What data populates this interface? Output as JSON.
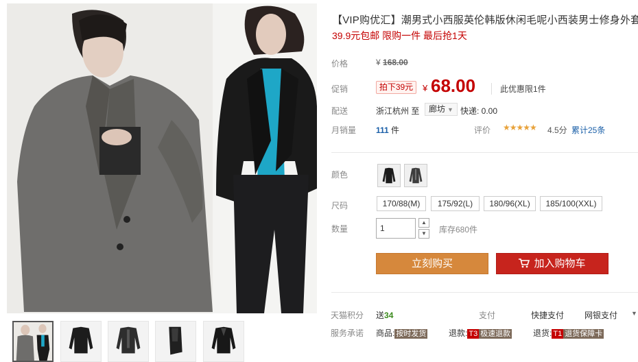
{
  "product": {
    "title": "【VIP购优汇】潮男式小西服英伦韩版休闲毛呢小西装男士修身外套",
    "subtitle": "39.9元包邮 限购一件 最后抢1天"
  },
  "labels": {
    "price": "价格",
    "promo": "促销",
    "shipping": "配送",
    "monthly_sales": "月销量",
    "rating": "评价",
    "color": "颜色",
    "size": "尺码",
    "quantity": "数量",
    "tmall_points": "天猫积分",
    "payment": "支付",
    "service": "服务承诺"
  },
  "price": {
    "currency": "¥",
    "original": "168.00",
    "promo_tag": "拍下39元",
    "current": "68.00",
    "limit_note": "此优惠限1件"
  },
  "shipping": {
    "from": "浙江杭州 至",
    "destination": "廊坊",
    "express": "快递: 0.00"
  },
  "sales": {
    "count": "111",
    "unit": " 件"
  },
  "rating": {
    "stars": 4.5,
    "stars_glyphs": "★★★★★",
    "score": "4.5分",
    "reviews": "累计25条"
  },
  "colors": [
    {
      "name": "black",
      "hex": "#1b1b1b"
    },
    {
      "name": "gray",
      "hex": "#6b6b6b"
    }
  ],
  "sizes": [
    "170/88(M)",
    "175/92(L)",
    "180/96(XL)",
    "185/100(XXL)"
  ],
  "quantity": {
    "value": "1",
    "stock": "库存680件"
  },
  "buttons": {
    "buy_now": "立刻购买",
    "add_to_cart": "加入购物车"
  },
  "points": {
    "prefix": "送",
    "value": "34"
  },
  "payment": {
    "method1": "快捷支付",
    "method2": "网银支付"
  },
  "service": {
    "item1_label": "商品:",
    "item1_badge": "按时发货",
    "item2_label": "退款:",
    "item2_badge_code": "T3",
    "item2_badge": "极速退款",
    "item3_label": "退货:",
    "item3_badge_code": "T1",
    "item3_badge": "退货保障卡"
  },
  "theme": {
    "price_red": "#c40000",
    "buy_orange": "#d6883c",
    "cart_red": "#c7241d",
    "link_blue": "#1a5fa8",
    "star_orange": "#e8a23a"
  },
  "icons": {
    "cart": "shopping-cart-icon",
    "dropdown": "chevron-down-icon",
    "spin_up": "chevron-up-icon",
    "spin_down": "chevron-down-icon"
  }
}
